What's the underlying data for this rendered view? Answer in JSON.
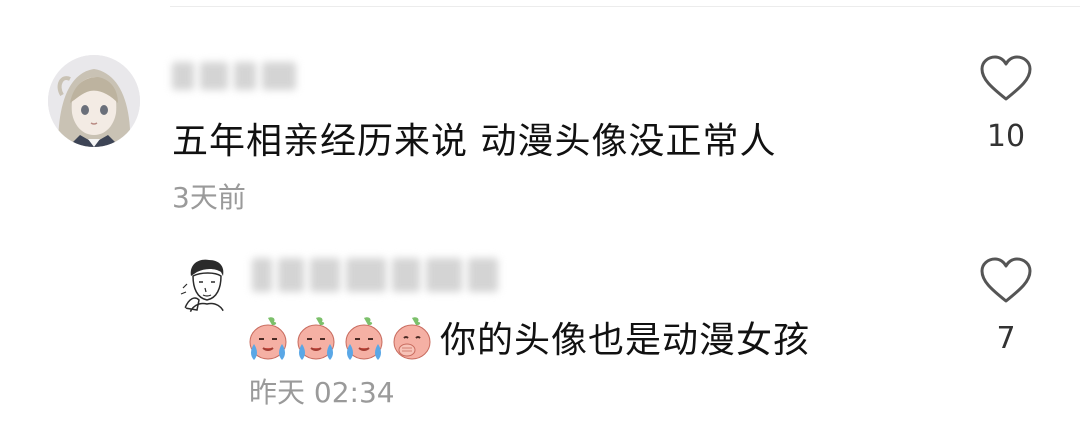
{
  "comments": [
    {
      "text": "五年相亲经历来说 动漫头像没正常人",
      "time": "3天前",
      "likes": "10",
      "avatar_icon": "anime-girl-avatar",
      "like_icon": "heart-outline-icon"
    }
  ],
  "reply": {
    "text": "你的头像也是动漫女孩",
    "time": "昨天 02:34",
    "likes": "7",
    "avatar_icon": "sketch-man-avatar",
    "emojis": [
      "crying-peach-emoji",
      "crying-peach-emoji",
      "crying-peach-emoji",
      "covering-mouth-peach-emoji"
    ],
    "like_icon": "heart-outline-icon"
  },
  "colors": {
    "text": "#111111",
    "muted": "#9a9a9a",
    "heart": "#555555",
    "peach": "#f5a9a0"
  }
}
